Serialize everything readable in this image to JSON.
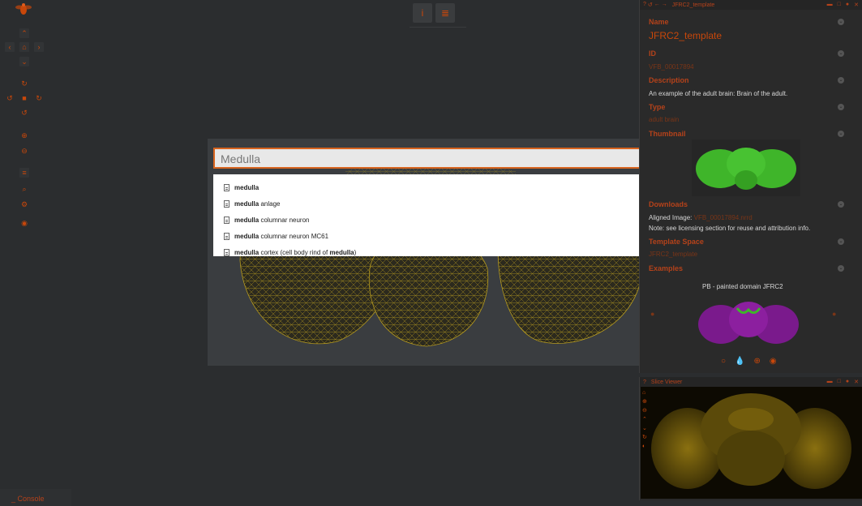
{
  "search": {
    "value": "Medulla",
    "suggestions": [
      {
        "bold_prefix": "medulla",
        "rest": "",
        "bold_suffix": ""
      },
      {
        "bold_prefix": "medulla",
        "rest": " anlage",
        "bold_suffix": ""
      },
      {
        "bold_prefix": "medulla",
        "rest": " columnar neuron",
        "bold_suffix": ""
      },
      {
        "bold_prefix": "medulla",
        "rest": " columnar neuron MC61",
        "bold_suffix": ""
      },
      {
        "bold_prefix": "medulla",
        "rest": " cortex (cell body rind of ",
        "bold_suffix": "medulla"
      }
    ],
    "suggestion_suffix_last": ")"
  },
  "term_panel": {
    "title": "JFRC2_template",
    "name_label": "Name",
    "name_value": "JFRC2_template",
    "id_label": "ID",
    "id_value": "VFB_00017894",
    "description_label": "Description",
    "description_value": "An example of the adult brain: Brain of the adult.",
    "type_label": "Type",
    "type_value": "adult brain",
    "thumbnail_label": "Thumbnail",
    "downloads_label": "Downloads",
    "aligned_image_label": "Aligned Image:",
    "aligned_image_link": "VFB_00017894.nrrd",
    "license_note": "Note: see licensing section for reuse and attribution info.",
    "template_space_label": "Template Space",
    "template_space_value": "JFRC2_template",
    "examples_label": "Examples",
    "example_caption": "PB - painted domain JFRC2"
  },
  "slice_panel": {
    "title": "Slice Viewer"
  },
  "console": {
    "label": "Console",
    "prefix": "_"
  },
  "colors": {
    "accent": "#c8470a",
    "background": "#2b2d2f",
    "mesh": "#b59a1f",
    "thumbnail_green": "#3fb52a",
    "example_purple": "#7a1a8c"
  }
}
